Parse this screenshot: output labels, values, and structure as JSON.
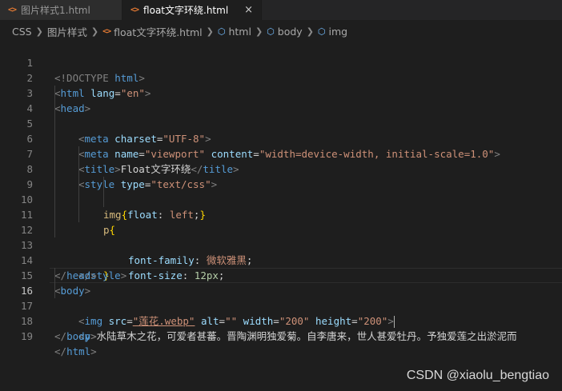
{
  "tabs": [
    {
      "label": "图片样式1.html",
      "icon": "html-icon"
    },
    {
      "label": "float文字环绕.html",
      "icon": "html-icon",
      "close": "×"
    }
  ],
  "breadcrumb": {
    "items": [
      "CSS",
      "图片样式",
      "float文字环绕.html",
      "html",
      "body",
      "img"
    ]
  },
  "editor": {
    "line_numbers": [
      "1",
      "2",
      "3",
      "4",
      "5",
      "6",
      "7",
      "8",
      "9",
      "10",
      "11",
      "12",
      "13",
      "14",
      "15",
      "16",
      "17",
      "18",
      "19"
    ],
    "current_line": "16",
    "line1": {
      "a": "<!DOCTYPE",
      "b": " html",
      "c": ">"
    },
    "line2": {
      "open": "<",
      "tag": "html",
      "attr": " lang",
      "eq": "=",
      "val": "\"en\"",
      "close": ">"
    },
    "line3": {
      "open": "<",
      "tag": "head",
      "close": ">"
    },
    "line4": {
      "open": "<",
      "tag": "meta",
      "attr": " charset",
      "eq": "=",
      "val": "\"UTF-8\"",
      "close": ">"
    },
    "line5": {
      "open": "<",
      "tag": "meta",
      "attr1": " name",
      "eq1": "=",
      "val1": "\"viewport\"",
      "attr2": " content",
      "eq2": "=",
      "val2": "\"width=device-width, initial-scale=1.0\"",
      "close": ">"
    },
    "line6": {
      "open": "<",
      "tag": "title",
      "close": ">",
      "text": "Float文字环绕",
      "open2": "</",
      "tag2": "title",
      "close2": ">"
    },
    "line7": {
      "open": "<",
      "tag": "style",
      "attr": " type",
      "eq": "=",
      "val": "\"text/css\"",
      "close": ">"
    },
    "line8": {
      "sel": "img",
      "brace1": "{",
      "prop": "float",
      "colon": ": ",
      "val": "left",
      "semi": ";",
      "brace2": "}"
    },
    "line9": {
      "sel": "p",
      "brace": "{"
    },
    "line10": {
      "prop": "font-family",
      "colon": ": ",
      "val": "微软雅黑",
      "semi": ";"
    },
    "line11": {
      "prop": "font-size",
      "colon": ": ",
      "num": "12px",
      "semi": ";"
    },
    "line12": {
      "brace": "}"
    },
    "line13": {
      "open": "</",
      "tag": "style",
      "close": ">"
    },
    "line14": {
      "open": "</",
      "tag": "head",
      "close": ">"
    },
    "line15": {
      "open": "<",
      "tag": "body",
      "close": ">"
    },
    "line16": {
      "open": "<",
      "tag": "img",
      "attr1": " src",
      "eq1": "=",
      "val1": "\"莲花.webp\"",
      "attr2": " alt",
      "eq2": "=",
      "val2": "\"\"",
      "attr3": " width",
      "eq3": "=",
      "val3": "\"200\"",
      "attr4": " height",
      "eq4": "=",
      "val4": "\"200\"",
      "close": ">"
    },
    "line17": {
      "open": "<",
      "tag": "p",
      "close": ">",
      "text": "水陆草木之花，可爱者甚蕃。晋陶渊明独爱菊。自李唐来，世人甚爱牡丹。予独爱莲之出淤泥而"
    },
    "line18": {
      "open": "</",
      "tag": "body",
      "close": ">"
    },
    "line19": {
      "open": "</",
      "tag": "html",
      "close": ">"
    }
  },
  "watermark": "CSDN @xiaolu_bengtiao"
}
